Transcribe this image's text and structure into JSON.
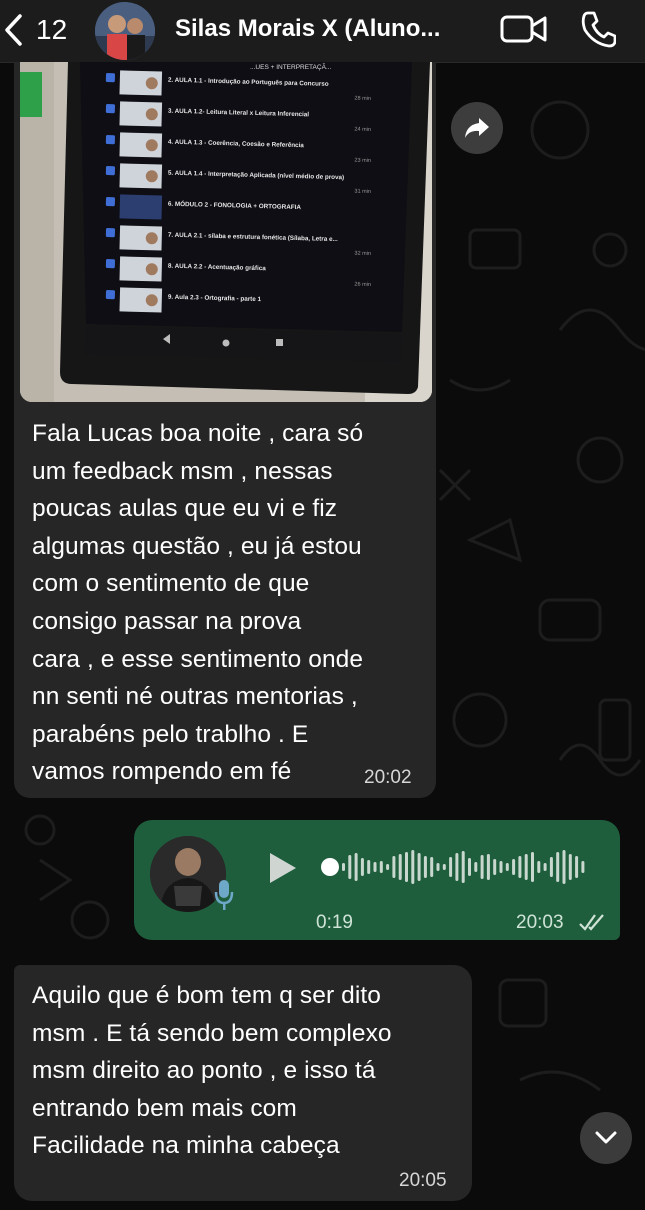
{
  "header": {
    "back_count": "12",
    "contact_name": "Silas Morais X (Aluno...",
    "icons": {
      "back": "chevron-left-icon",
      "video": "video-camera-icon",
      "call": "phone-icon"
    }
  },
  "messages": [
    {
      "type": "image-with-caption",
      "direction": "incoming",
      "photo": {
        "header_text": "...UES + INTERPRETAÇÃ...",
        "lessons": [
          {
            "title": "2. AULA 1.1 - Introdução ao Português para Concurso",
            "duration": "28 min"
          },
          {
            "title": "3. AULA 1.2- Leitura Literal x Leitura Inferencial",
            "duration": "24 min"
          },
          {
            "title": "4. AULA 1.3 - Coerência, Coesão e Referência",
            "duration": "23 min"
          },
          {
            "title": "5. AULA 1.4 - Interpretação Aplicada (nível médio de prova)",
            "duration": "31 min"
          },
          {
            "title": "6. MÓDULO 2 - FONOLOGIA + ORTOGRAFIA",
            "duration": ""
          },
          {
            "title": "7. AULA 2.1 - sílaba e estrutura fonética (Sílaba, Letra e...",
            "duration": "32 min"
          },
          {
            "title": "8. AULA 2.2 - Acentuação gráfica",
            "duration": "26 min"
          },
          {
            "title": "9. Aula 2.3 - Ortografia - parte 1",
            "duration": ""
          }
        ]
      },
      "text": "Fala Lucas boa noite , cara só\num feedback msm , nessas\npoucas aulas que eu vi e fiz\nalgumas questão , eu já estou\ncom o sentimento de que\nconsigo passar na prova\ncara , e esse sentimento onde\nnn senti né outras mentorias ,\nparabéns pelo trablho . E\nvamos rompendo em fé",
      "time": "20:02"
    },
    {
      "type": "voice",
      "direction": "outgoing",
      "duration": "0:19",
      "time": "20:03",
      "status": "read"
    },
    {
      "type": "text",
      "direction": "incoming",
      "text": "Aquilo que é bom tem q ser dito\nmsm . E tá sendo bem complexo\nmsm direito ao ponto , e isso tá\nentrando bem mais com\nFacilidade na minha cabeça",
      "time": "20:05"
    }
  ],
  "colors": {
    "header_bg": "#1c1c1c",
    "chat_bg": "#0b0b0b",
    "incoming_bubble": "#262626",
    "outgoing_bubble": "#1e5e3d"
  }
}
